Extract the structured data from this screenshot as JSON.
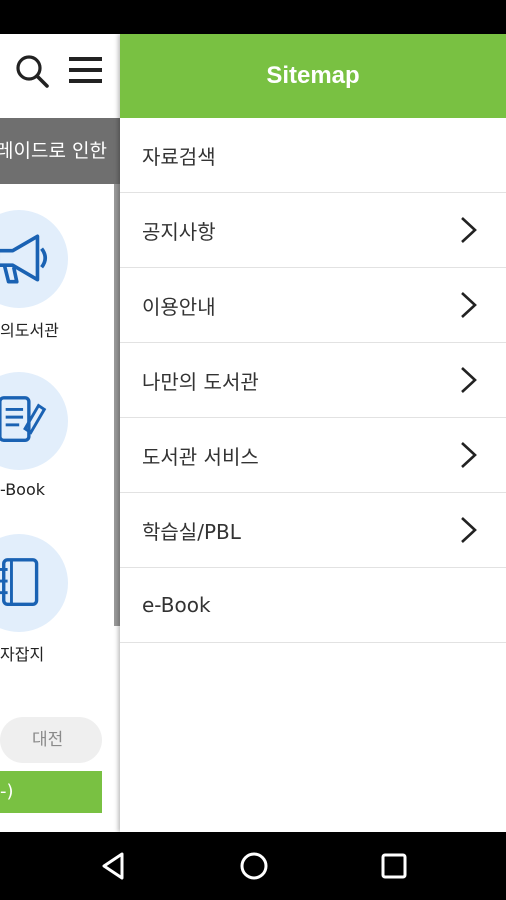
{
  "background_page": {
    "notice_text": "레이드로 인한",
    "items": [
      {
        "label": "의도서관",
        "icon": "megaphone-icon"
      },
      {
        "label": "-Book",
        "icon": "ebook-tablet-icon"
      },
      {
        "label": "자잡지",
        "icon": "notebook-icon"
      }
    ],
    "location_pill": "대전",
    "green_bar_text": "-)"
  },
  "drawer": {
    "title": "Sitemap",
    "items": [
      {
        "label": "자료검색",
        "has_submenu": false
      },
      {
        "label": "공지사항",
        "has_submenu": true
      },
      {
        "label": "이용안내",
        "has_submenu": true
      },
      {
        "label": "나만의 도서관",
        "has_submenu": true
      },
      {
        "label": "도서관 서비스",
        "has_submenu": true
      },
      {
        "label": "학습실/PBL",
        "has_submenu": true
      },
      {
        "label": "e-Book",
        "has_submenu": false
      }
    ]
  },
  "navigation": {
    "back": "back-triangle-icon",
    "home": "home-circle-icon",
    "recents": "recents-square-icon"
  },
  "colors": {
    "accent_green": "#79c142",
    "notice_gray": "#6f6f6f",
    "icon_blue": "#1a62b3",
    "circle_bg": "#e2eefb"
  }
}
